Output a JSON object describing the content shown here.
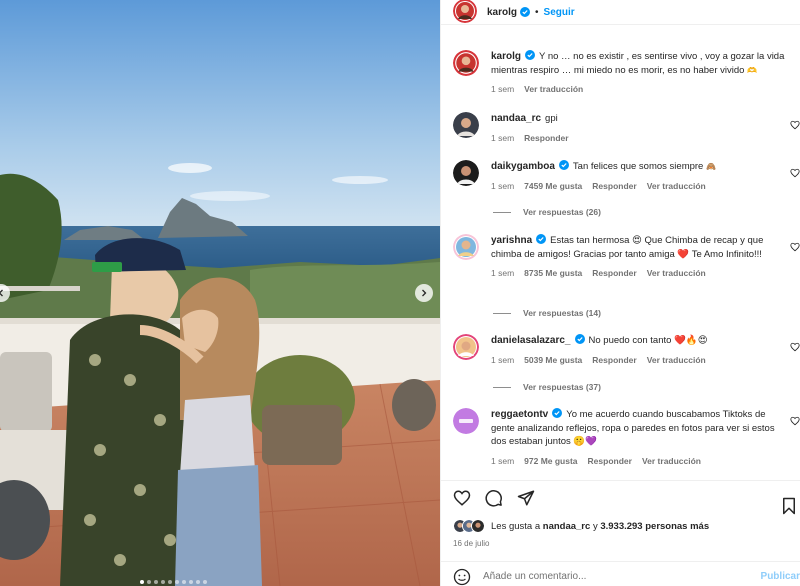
{
  "post": {
    "author": "karolg",
    "separator": "•",
    "follow_label": "Seguir",
    "caption": "Y no … no es existir , es sentirse vivo , voy a gozar la vida mientras respiro … mi miedo no es morir, es no haber vivido",
    "caption_emoji": "🫶",
    "caption_time": "1 sem",
    "caption_translate": "Ver traducción"
  },
  "comments": [
    {
      "user": "nandaa_rc",
      "verified": false,
      "text": "gpi",
      "time": "1 sem",
      "likes": "",
      "reply_label": "Responder",
      "translate_label": "",
      "replies_label": ""
    },
    {
      "user": "daikygamboa",
      "verified": true,
      "text": "Tan felices que somos siempre",
      "emoji": "🙈",
      "time": "1 sem",
      "likes": "7459 Me gusta",
      "reply_label": "Responder",
      "translate_label": "Ver traducción",
      "replies_label": "Ver respuestas (26)"
    },
    {
      "user": "yarishna",
      "verified": true,
      "text": "Estas tan hermosa 😍 Que Chimba de recap y que chimba de amigos! Gracias por tanto amiga ❤️ Te Amo Infinito!!!",
      "time": "1 sem",
      "likes": "8735 Me gusta",
      "reply_label": "Responder",
      "translate_label": "Ver traducción",
      "replies_label": "Ver respuestas (14)"
    },
    {
      "user": "danielasalazarc_",
      "verified": true,
      "text": "No puedo con tanto ❤️🔥😍",
      "time": "1 sem",
      "likes": "5039 Me gusta",
      "reply_label": "Responder",
      "translate_label": "Ver traducción",
      "replies_label": "Ver respuestas (37)"
    },
    {
      "user": "reggaetontv",
      "verified": true,
      "text": "Yo me acuerdo cuando buscabamos Tiktoks de gente analizando reflejos, ropa o paredes en fotos para ver si estos dos estaban juntos 🤫💜",
      "time": "1 sem",
      "likes": "972 Me gusta",
      "reply_label": "Responder",
      "translate_label": "Ver traducción",
      "replies_label": ""
    }
  ],
  "likes": {
    "prefix": "Les gusta a",
    "first_user": "nandaa_rc",
    "middle": "y",
    "count": "3.933.293 personas más"
  },
  "date": "16 de julio",
  "add_comment": {
    "placeholder": "Añade un comentario...",
    "publish_label": "Publicar"
  },
  "icons": {
    "verified": "verified-badge-icon",
    "heart": "heart-icon",
    "comment": "comment-icon",
    "share": "share-icon",
    "save": "bookmark-icon",
    "emoji": "emoji-icon",
    "chevron_left": "chevron-left-icon",
    "chevron_right": "chevron-right-icon"
  },
  "colors": {
    "accent": "#0095f6",
    "publish_disabled": "#8fcdfa",
    "muted_text": "#737373",
    "text": "#262626"
  },
  "carousel": {
    "total": 10,
    "active": 1
  }
}
